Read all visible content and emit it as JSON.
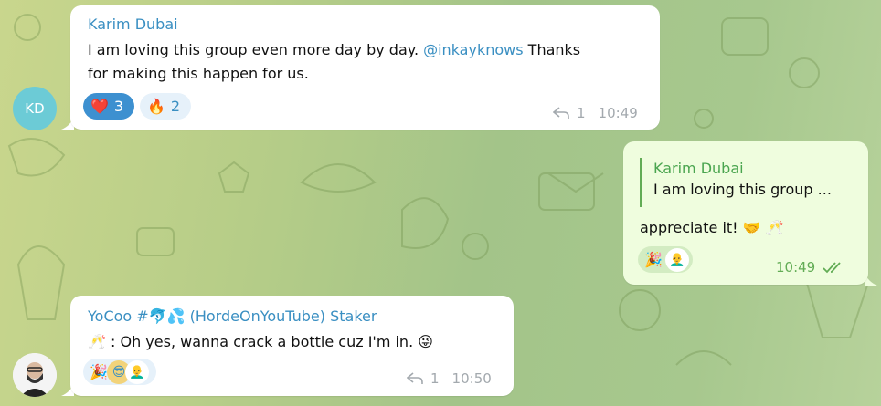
{
  "messages": [
    {
      "sender": "Karim Dubai",
      "avatar_initials": "KD",
      "text_before": "I am loving this group even more day by day. ",
      "mention": "@inkayknows",
      "text_after": " Thanks",
      "text_line2": "for making this happen for us.",
      "reactions": [
        {
          "emoji": "❤️",
          "count": "3"
        },
        {
          "emoji": "🔥",
          "count": "2"
        }
      ],
      "reply_count": "1",
      "time": "10:49"
    },
    {
      "quoted_sender": "Karim Dubai",
      "quoted_text": "I am loving this group ...",
      "text": "appreciate it! 🤝 🥂",
      "reactions": [
        "🎉",
        "👨‍🦲"
      ],
      "time": "10:49",
      "status": "read"
    },
    {
      "sender": "YoCoo #🐬💦 (HordeOnYouTube) Staker",
      "text": "🥂 : Oh yes, wanna crack a bottle cuz I'm in. 😜",
      "reactions": [
        "🎉",
        "😎",
        "👨‍🦲"
      ],
      "reply_count": "1",
      "time": "10:50"
    }
  ],
  "colors": {
    "accent": "#3a8fc2",
    "outgoing_bubble": "#effdde",
    "read_check": "#62ac55",
    "avatar_kd": "#6ccbd6"
  },
  "icons": [
    "reply-arrow-icon",
    "double-check-icon"
  ]
}
